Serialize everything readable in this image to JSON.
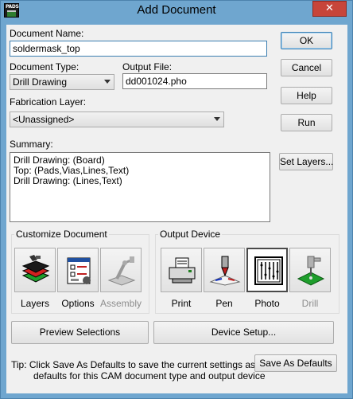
{
  "window": {
    "title": "Add Document",
    "app_icon_text": "PADS",
    "close_symbol": "✕"
  },
  "document_name": {
    "label": "Document Name:",
    "value": "soldermask_top"
  },
  "document_type": {
    "label": "Document Type:",
    "value": "Drill Drawing"
  },
  "output_file": {
    "label": "Output File:",
    "value": "dd001024.pho"
  },
  "fabrication_layer": {
    "label": "Fabrication Layer:",
    "value": "<Unassigned>"
  },
  "summary": {
    "label": "Summary:",
    "lines": [
      "Drill Drawing: (Board)",
      "Top: (Pads,Vias,Lines,Text)",
      "Drill Drawing: (Lines,Text)"
    ]
  },
  "buttons": {
    "ok": "OK",
    "cancel": "Cancel",
    "help": "Help",
    "run": "Run",
    "set_layers": "Set Layers...",
    "preview_selections": "Preview Selections",
    "device_setup": "Device Setup...",
    "save_as_defaults": "Save As Defaults"
  },
  "customize_document": {
    "title": "Customize Document",
    "items": [
      {
        "label": "Layers",
        "icon": "layers-icon",
        "enabled": true
      },
      {
        "label": "Options",
        "icon": "options-icon",
        "enabled": true
      },
      {
        "label": "Assembly",
        "icon": "assembly-icon",
        "enabled": false
      }
    ]
  },
  "output_device": {
    "title": "Output Device",
    "items": [
      {
        "label": "Print",
        "icon": "printer-icon",
        "enabled": true,
        "selected": false
      },
      {
        "label": "Pen",
        "icon": "pen-plotter-icon",
        "enabled": true,
        "selected": false
      },
      {
        "label": "Photo",
        "icon": "photo-plotter-icon",
        "enabled": true,
        "selected": true
      },
      {
        "label": "Drill",
        "icon": "drill-icon",
        "enabled": false,
        "selected": false
      }
    ]
  },
  "tip": {
    "line1": "Tip: Click Save As Defaults to save the current settings as the",
    "line2": "defaults for this CAM document type and output device"
  },
  "colors": {
    "title_bar": "#6fa6cf",
    "close_button": "#c7453a",
    "dialog_bg": "#f0f0f0",
    "focus_border": "#3c7fb1"
  }
}
